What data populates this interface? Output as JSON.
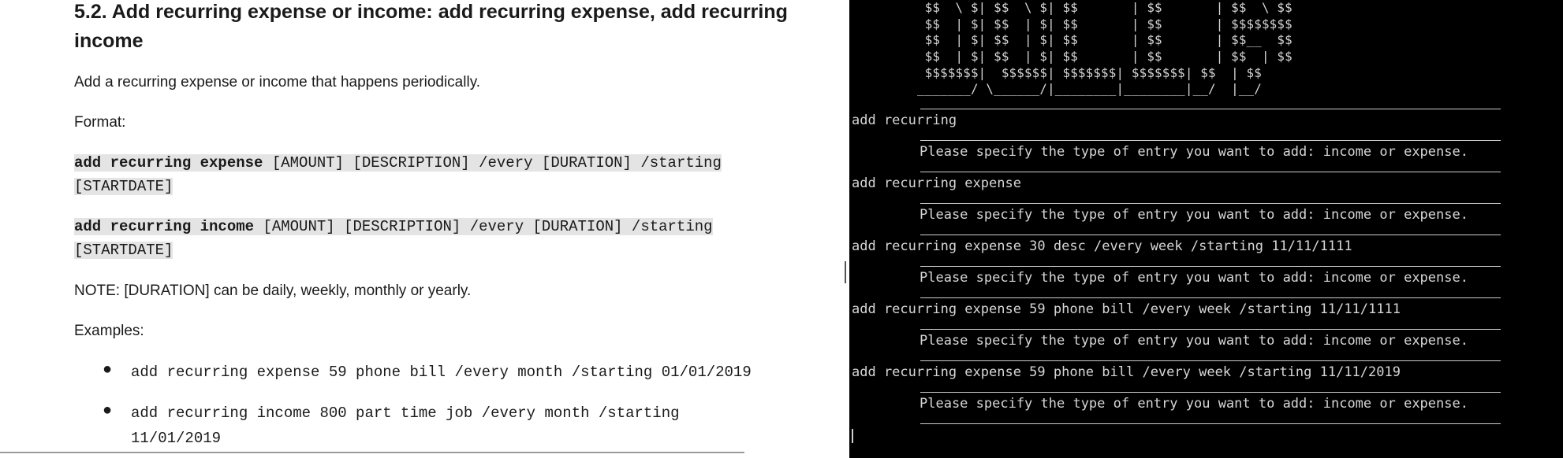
{
  "doc": {
    "heading": "5.2. Add recurring expense or income: add recurring expense, add recurring income",
    "intro": "Add a recurring expense or income that happens periodically.",
    "format_label": "Format:",
    "format_expense_cmd": "add recurring expense",
    "format_expense_args": " [AMOUNT] [DESCRIPTION] /every [DURATION] /starting [STARTDATE]",
    "format_income_cmd": "add recurring income",
    "format_income_args": " [AMOUNT] [DESCRIPTION] /every [DURATION] /starting [STARTDATE]",
    "note": "NOTE: [DURATION] can be daily, weekly, monthly or yearly.",
    "examples_label": "Examples:",
    "examples": [
      "add recurring expense 59 phone bill /every month /starting 01/01/2019",
      "add recurring income 800 part time job /every month /starting 11/01/2019"
    ]
  },
  "terminal": {
    "ascii_art": [
      " $$  \\ $| $$  \\ $| $$       | $$       | $$  \\ $$",
      " $$  | $| $$  | $| $$       | $$       | $$$$$$$$",
      " $$  | $| $$  | $| $$       | $$       | $$__  $$",
      " $$  | $| $$  | $| $$       | $$       | $$  | $$",
      " $$$$$$$|  $$$$$$| $$$$$$$| $$$$$$$| $$  | $$",
      "_______/ \\______/|________|________|__/  |__/"
    ],
    "entries": [
      {
        "command": "add recurring",
        "response": "Please specify the type of entry you want to add: income or expense."
      },
      {
        "command": "add recurring expense",
        "response": "Please specify the type of entry you want to add: income or expense."
      },
      {
        "command": "add recurring expense 30 desc /every week /starting 11/11/1111",
        "response": "Please specify the type of entry you want to add: income or expense."
      },
      {
        "command": "add recurring expense 59 phone bill /every week /starting 11/11/1111",
        "response": "Please specify the type of entry you want to add: income or expense."
      },
      {
        "command": "add recurring expense 59 phone bill /every week /starting 11/11/2019",
        "response": "Please specify the type of entry you want to add: income or expense."
      }
    ]
  }
}
